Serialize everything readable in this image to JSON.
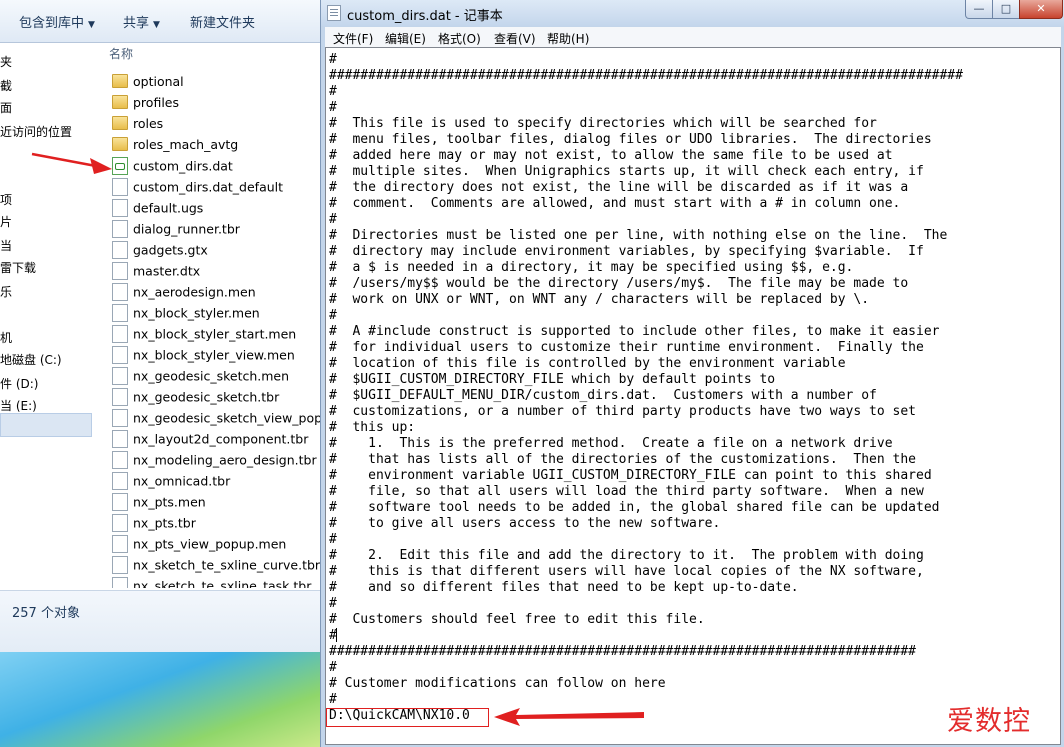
{
  "explorer": {
    "toolbar": {
      "include_library": "包含到库中",
      "share": "共享",
      "new_folder": "新建文件夹"
    },
    "nav_items": [
      "夹",
      "截",
      "面",
      "近访问的位置",
      "",
      "",
      "项",
      "片",
      "当",
      "雷下载",
      "乐",
      "",
      "机",
      "地磁盘 (C:)",
      "件 (D:)",
      "当 (E:)"
    ],
    "column_header": "名称",
    "files": [
      {
        "name": "optional",
        "type": "folder"
      },
      {
        "name": "profiles",
        "type": "folder"
      },
      {
        "name": "roles",
        "type": "folder"
      },
      {
        "name": "roles_mach_avtg",
        "type": "folder"
      },
      {
        "name": "custom_dirs.dat",
        "type": "dat"
      },
      {
        "name": "custom_dirs.dat_default",
        "type": "file"
      },
      {
        "name": "default.ugs",
        "type": "file"
      },
      {
        "name": "dialog_runner.tbr",
        "type": "file"
      },
      {
        "name": "gadgets.gtx",
        "type": "file"
      },
      {
        "name": "master.dtx",
        "type": "file"
      },
      {
        "name": "nx_aerodesign.men",
        "type": "file"
      },
      {
        "name": "nx_block_styler.men",
        "type": "file"
      },
      {
        "name": "nx_block_styler_start.men",
        "type": "file"
      },
      {
        "name": "nx_block_styler_view.men",
        "type": "file"
      },
      {
        "name": "nx_geodesic_sketch.men",
        "type": "file"
      },
      {
        "name": "nx_geodesic_sketch.tbr",
        "type": "file"
      },
      {
        "name": "nx_geodesic_sketch_view_popup",
        "type": "file"
      },
      {
        "name": "nx_layout2d_component.tbr",
        "type": "file"
      },
      {
        "name": "nx_modeling_aero_design.tbr",
        "type": "file"
      },
      {
        "name": "nx_omnicad.tbr",
        "type": "file"
      },
      {
        "name": "nx_pts.men",
        "type": "file"
      },
      {
        "name": "nx_pts.tbr",
        "type": "file"
      },
      {
        "name": "nx_pts_view_popup.men",
        "type": "file"
      },
      {
        "name": "nx_sketch_te_sxline_curve.tbr",
        "type": "file"
      },
      {
        "name": "nx_sketch_te_sxline_task.tbr",
        "type": "file"
      }
    ],
    "status": "257 个对象"
  },
  "notepad": {
    "title": "custom_dirs.dat - 记事本",
    "window_buttons": {
      "minimize": "—",
      "maximize": "□",
      "close": "✕"
    },
    "menu": [
      "文件(F)",
      "编辑(E)",
      "格式(O)",
      "查看(V)",
      "帮助(H)"
    ],
    "lines": [
      "#",
      "#################################################################################",
      "#",
      "#",
      "#  This file is used to specify directories which will be searched for",
      "#  menu files, toolbar files, dialog files or UDO libraries.  The directories",
      "#  added here may or may not exist, to allow the same file to be used at",
      "#  multiple sites.  When Unigraphics starts up, it will check each entry, if",
      "#  the directory does not exist, the line will be discarded as if it was a",
      "#  comment.  Comments are allowed, and must start with a # in column one.",
      "#",
      "#  Directories must be listed one per line, with nothing else on the line.  The",
      "#  directory may include environment variables, by specifying $variable.  If",
      "#  a $ is needed in a directory, it may be specified using $$, e.g.",
      "#  /users/my$$ would be the directory /users/my$.  The file may be made to",
      "#  work on UNX or WNT, on WNT any / characters will be replaced by \\.",
      "#",
      "#  A #include construct is supported to include other files, to make it easier",
      "#  for individual users to customize their runtime environment.  Finally the",
      "#  location of this file is controlled by the environment variable",
      "#  $UGII_CUSTOM_DIRECTORY_FILE which by default points to",
      "#  $UGII_DEFAULT_MENU_DIR/custom_dirs.dat.  Customers with a number of",
      "#  customizations, or a number of third party products have two ways to set",
      "#  this up:",
      "#    1.  This is the preferred method.  Create a file on a network drive",
      "#    that has lists all of the directories of the customizations.  Then the",
      "#    environment variable UGII_CUSTOM_DIRECTORY_FILE can point to this shared",
      "#    file, so that all users will load the third party software.  When a new",
      "#    software tool needs to be added in, the global shared file can be updated",
      "#    to give all users access to the new software.",
      "#",
      "#    2.  Edit this file and add the directory to it.  The problem with doing",
      "#    this is that different users will have local copies of the NX software,",
      "#    and so different files that need to be kept up-to-date.",
      "#",
      "#  Customers should feel free to edit this file.",
      "#",
      "###########################################################################",
      "#",
      "# Customer modifications can follow on here",
      "#",
      "D:\\QuickCAM\\NX10.0"
    ],
    "watermark": "爱数控"
  },
  "colors": {
    "annotation_red": "#e02020",
    "selection_blue": "#dbe6f3",
    "chrome_blue": "#c3d5ea"
  }
}
